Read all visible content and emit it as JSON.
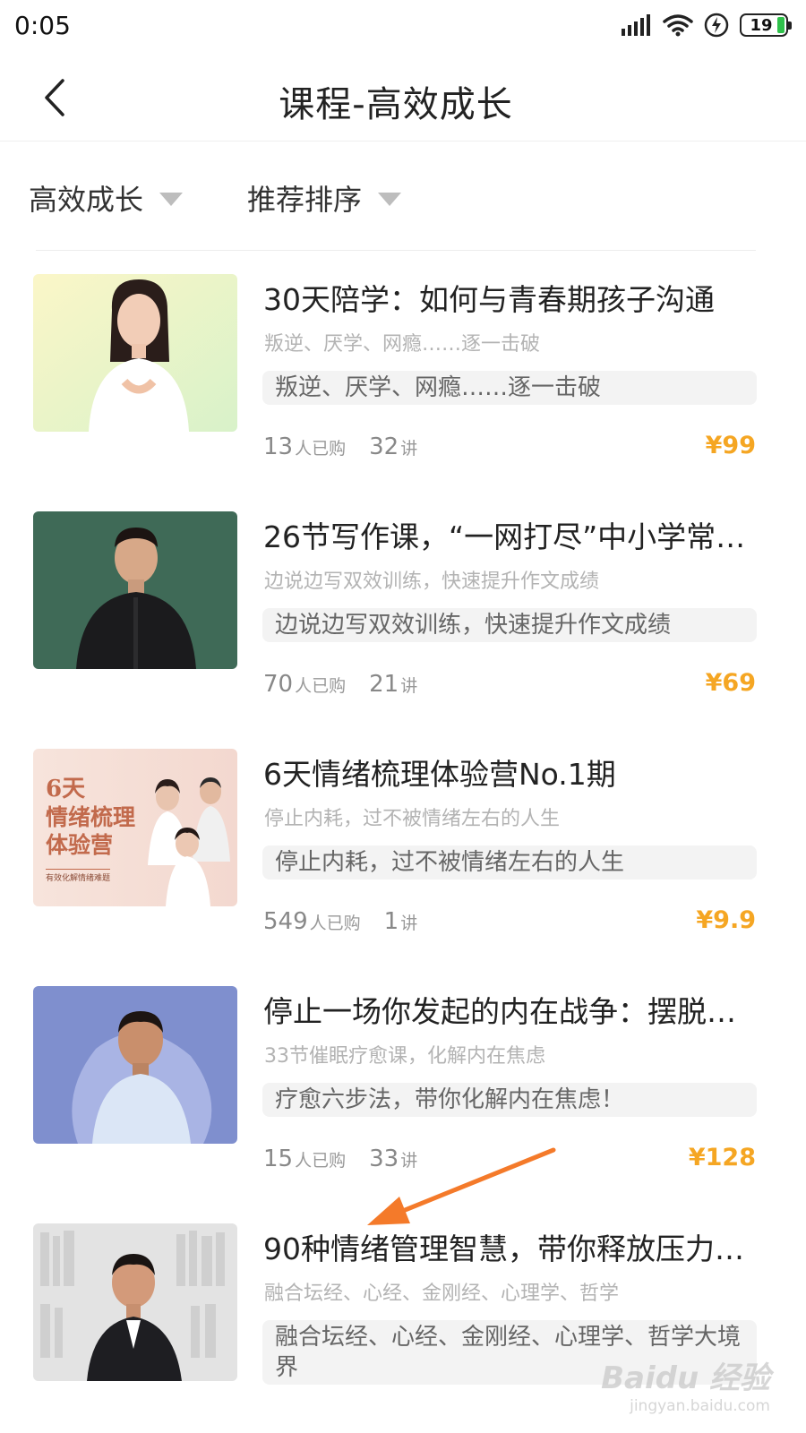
{
  "status_bar": {
    "time": "0:05",
    "battery": "19",
    "icons": [
      "signal-icon",
      "wifi-icon",
      "charging-icon",
      "battery-icon"
    ]
  },
  "nav": {
    "back_icon": "chevron-left-icon",
    "title": "课程-高效成长"
  },
  "filters": {
    "category": "高效成长",
    "sort": "推荐排序"
  },
  "labels": {
    "bought": "人已购",
    "lectures": "讲"
  },
  "courses": [
    {
      "title": "30天陪学：如何与青春期孩子沟通",
      "subtitle": "叛逆、厌学、网瘾……逐一击破",
      "tag": "叛逆、厌学、网瘾……逐一击破",
      "buyers": "13",
      "lessons": "32",
      "price": "¥99"
    },
    {
      "title": "26节写作课，“一网打尽”中小学常…",
      "subtitle": "边说边写双效训练，快速提升作文成绩",
      "tag": "边说边写双效训练，快速提升作文成绩",
      "buyers": "70",
      "lessons": "21",
      "price": "¥69"
    },
    {
      "title": "6天情绪梳理体验营No.1期",
      "subtitle": "停止内耗，过不被情绪左右的人生",
      "tag": "停止内耗，过不被情绪左右的人生",
      "buyers": "549",
      "lessons": "1",
      "price": "¥9.9",
      "poster": {
        "line1": "6天",
        "line2": "情绪梳理",
        "line3": "体验营",
        "caption": "有效化解情绪难题"
      }
    },
    {
      "title": "停止一场你发起的内在战争：摆脱…",
      "subtitle": "33节催眠疗愈课，化解内在焦虑",
      "tag": "疗愈六步法，带你化解内在焦虑！",
      "buyers": "15",
      "lessons": "33",
      "price": "¥128"
    },
    {
      "title": "90种情绪管理智慧，带你释放压力…",
      "subtitle": "融合坛经、心经、金刚经、心理学、哲学",
      "tag": "融合坛经、心经、金刚经、心理学、哲学大境界"
    }
  ],
  "watermark": {
    "brand": "Baidu 经验",
    "url": "jingyan.baidu.com"
  },
  "colors": {
    "price": "#f5a623",
    "annotation_arrow": "#f47a2a",
    "battery_fill": "#2fc14b"
  }
}
